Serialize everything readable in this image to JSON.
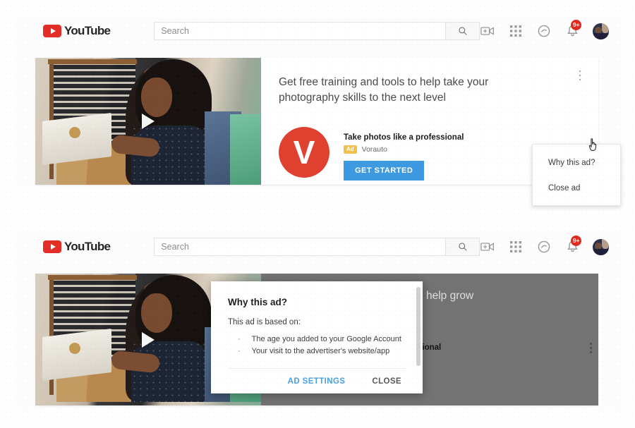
{
  "header": {
    "menu_icon": "hamburger-icon",
    "logo_text": "YouTube",
    "search": {
      "value": "",
      "placeholder": "Search"
    },
    "search_icon": "search-icon",
    "icons": [
      {
        "name": "video-camera-icon",
        "label": ""
      },
      {
        "name": "apps-grid-icon",
        "label": ""
      },
      {
        "name": "message-icon",
        "label": ""
      },
      {
        "name": "bell-icon",
        "label": ""
      }
    ],
    "notification_badge": "9+",
    "avatar": "user-avatar"
  },
  "ad": {
    "headline": "Get free training and tools to help take your photography skills to the next level",
    "brand_letter": "V",
    "brand_title": "Take photos like a professional",
    "ad_chip": "Ad",
    "advertiser": "Vorauto",
    "cta_label": "GET STARTED",
    "kebab_icon": "more-options-icon",
    "play_icon": "play-icon"
  },
  "menu": {
    "items": [
      {
        "label": "Why this ad?"
      },
      {
        "label": "Close ad"
      }
    ]
  },
  "dialog": {
    "title": "Why this ad?",
    "subtitle": "This ad is based on:",
    "bullet_char": "·",
    "reasons": [
      "The age you added to your Google Account",
      "Your visit to the advertiser's website/app"
    ],
    "primary_label": "AD SETTINGS",
    "secondary_label": "CLOSE"
  },
  "behind": {
    "headline_fragment": "help grow",
    "brand_fragment": "sional"
  },
  "colors": {
    "youtube_red": "#e52d27",
    "brand_red": "#e0402f",
    "cta_blue": "#3d9ae0",
    "ad_chip_yellow": "#f2c14b",
    "badge_red": "#e02a1f",
    "link_blue": "#4a9fe0"
  }
}
